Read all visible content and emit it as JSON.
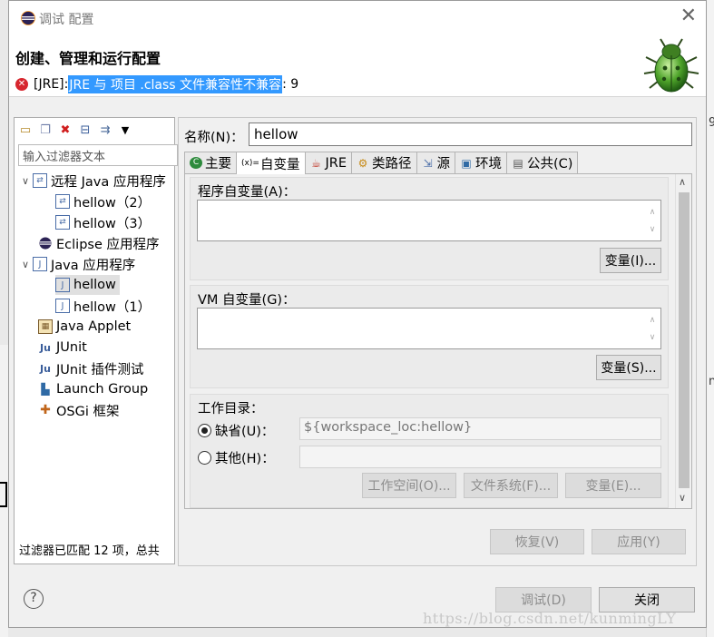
{
  "window": {
    "title": "调试 配置"
  },
  "header": {
    "title": "创建、管理和运行配置",
    "error_prefix": "[JRE]: ",
    "error_selected": "JRE 与 项目 .class 文件兼容性不兼容",
    "error_suffix": " : 9"
  },
  "left": {
    "filter_placeholder": "输入过滤器文本",
    "tree": [
      {
        "label": "远程 Java 应用程序",
        "expanded": true,
        "icon": "remote-java-icon"
      },
      {
        "label": "hellow（2）",
        "icon": "launch-config-icon"
      },
      {
        "label": "hellow（3）",
        "icon": "launch-config-icon"
      },
      {
        "label": "Eclipse 应用程序",
        "icon": "eclipse-icon"
      },
      {
        "label": "Java 应用程序",
        "expanded": true,
        "icon": "java-app-icon"
      },
      {
        "label": "hellow",
        "selected": true,
        "icon": "java-config-icon"
      },
      {
        "label": "hellow（1）",
        "icon": "java-config-icon"
      },
      {
        "label": "Java Applet",
        "icon": "applet-icon"
      },
      {
        "label": "JUnit",
        "icon": "junit-icon"
      },
      {
        "label": "JUnit 插件测试",
        "icon": "junit-plugin-icon"
      },
      {
        "label": "Launch Group",
        "icon": "launch-group-icon"
      },
      {
        "label": "OSGi 框架",
        "icon": "osgi-icon"
      }
    ],
    "status": "过滤器已匹配 12 项，总共"
  },
  "main": {
    "name_label": "名称(N)：",
    "name_value": "hellow",
    "tabs": [
      {
        "label": "主要",
        "icon": "main-tab-icon"
      },
      {
        "label": "自变量",
        "icon": "arguments-icon",
        "active": true
      },
      {
        "label": "JRE",
        "icon": "jre-icon"
      },
      {
        "label": "类路径",
        "icon": "classpath-icon"
      },
      {
        "label": "源",
        "icon": "source-icon"
      },
      {
        "label": "环境",
        "icon": "environment-icon"
      },
      {
        "label": "公共(C)",
        "icon": "common-icon"
      }
    ],
    "program_args_label": "程序自变量(A)：",
    "program_vars_button": "变量(I)...",
    "vm_args_label": "VM 自变量(G)：",
    "vm_vars_button": "变量(S)...",
    "workdir_label": "工作目录：",
    "default_label": "缺省(U)：",
    "default_value": "${workspace_loc:hellow}",
    "other_label": "其他(H)：",
    "other_value": "",
    "workspace_button": "工作空间(O)...",
    "filesystem_button": "文件系统(F)...",
    "variables_button": "变量(E)...",
    "revert_button": "恢复(V)",
    "apply_button": "应用(Y)"
  },
  "footer": {
    "debug_button": "调试(D)",
    "close_button": "关闭"
  },
  "watermark": "https://blog.csdn.net/kunmingLY",
  "colors": {
    "selection": "#3399ff",
    "error": "#d7262e"
  }
}
